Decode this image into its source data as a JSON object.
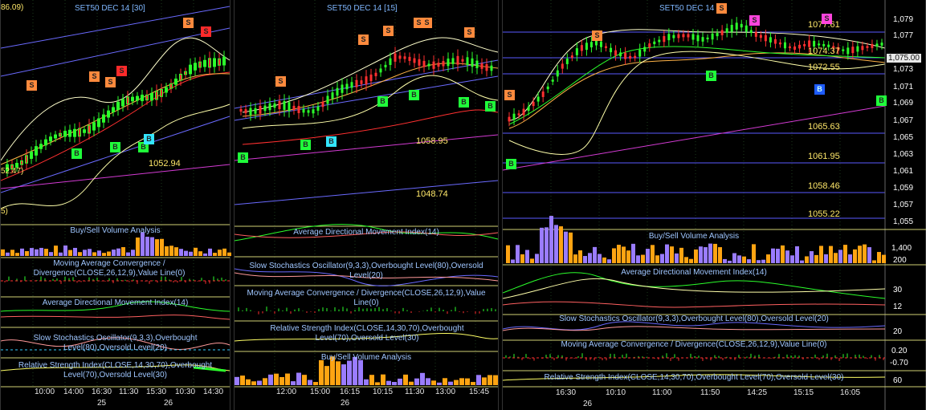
{
  "panels": [
    {
      "title": "SET50 DEC 14   [30]",
      "partial_value_top": "86.09)",
      "partial_value_left": "52.47)",
      "partial_value_small": "5)",
      "price_labels": [
        "1052.94"
      ],
      "indicators": [
        "Buy/Sell Volume Analysis",
        "Moving Average Convergence / Divergence(CLOSE,26,12,9),Value Line(0)",
        "Average Directional Movement Index(14)",
        "Slow Stochastics Oscillator(9,3,3),Overbought Level(80),Oversold Level(20)",
        "Relative Strength Index(CLOSE,14,30,70),Overbought Level(70),Oversold Level(30)"
      ],
      "x_ticks": [
        "10:00",
        "14:00",
        "16:30",
        "11:30",
        "15:30",
        "10:30",
        "14:30"
      ],
      "dates": [
        "25",
        "26"
      ],
      "signals": [
        "S",
        "S",
        "S",
        "S",
        "S",
        "S",
        "B",
        "B",
        "B",
        "B"
      ]
    },
    {
      "title": "SET50 DEC 14   [15]",
      "price_labels": [
        "1058.95",
        "1048.74"
      ],
      "indicators": [
        "Average Directional Movement Index(14)",
        "Slow Stochastics Oscillator(9,3,3),Overbought Level(80),Oversold Level(20)",
        "Moving Average Convergence / Divergence(CLOSE,26,12,9),Value Line(0)",
        "Relative Strength Index(CLOSE,14,30,70),Overbought Level(70),Oversold Level(30)",
        "Buy/Sell Volume Analysis"
      ],
      "x_ticks": [
        "12:00",
        "15:00",
        "16:15",
        "10:15",
        "11:30",
        "13:00",
        "15:45"
      ],
      "dates": [
        "26"
      ],
      "signals": [
        "S",
        "S",
        "S",
        "S",
        "S",
        "S",
        "B",
        "B",
        "B",
        "B",
        "B",
        "B",
        "B"
      ]
    },
    {
      "title": "SET50 DEC 14  [5]",
      "price_labels": [
        "1077.61",
        "1074.37",
        "1072.55",
        "1065.63",
        "1061.95",
        "1058.46",
        "1055.22"
      ],
      "price_axis": [
        "1,079",
        "1,077",
        "1,075.00",
        "1,073",
        "1,071",
        "1,069",
        "1,067",
        "1,065",
        "1,063",
        "1,061",
        "1,059",
        "1,057",
        "1,055"
      ],
      "vol_axis": [
        "1,400",
        "200"
      ],
      "adx_axis": [
        "30",
        "12"
      ],
      "stoch_axis": [
        "20"
      ],
      "macd_axis": [
        "0.20",
        "-0.70"
      ],
      "rsi_axis": [
        "60"
      ],
      "indicators": [
        "Buy/Sell Volume Analysis",
        "Average Directional Movement Index(14)",
        "Slow Stochastics Oscillator(9,3,3),Overbought Level(80),Oversold Level(20)",
        "Moving Average Convergence / Divergence(CLOSE,26,12,9),Value Line(0)",
        "Relative Strength Index(CLOSE,14,30,70),Overbought Level(70),Oversold Level(30)"
      ],
      "x_ticks": [
        "16:30",
        "10:10",
        "11:00",
        "11:50",
        "14:25",
        "15:15",
        "16:05"
      ],
      "dates": [
        "26"
      ],
      "signals": [
        "S",
        "S",
        "S",
        "S",
        "B",
        "B",
        "B",
        "B"
      ]
    }
  ],
  "chart_data": [
    {
      "type": "candlestick",
      "title": "SET50 DEC 14   [30]",
      "x": [
        "10:00",
        "14:00",
        "16:30",
        "11:30",
        "15:30",
        "10:30",
        "14:30"
      ],
      "price_levels": [
        1052.94
      ]
    },
    {
      "type": "candlestick",
      "title": "SET50 DEC 14   [15]",
      "x": [
        "12:00",
        "15:00",
        "16:15",
        "10:15",
        "11:30",
        "13:00",
        "15:45"
      ],
      "price_levels": [
        1058.95,
        1048.74
      ]
    },
    {
      "type": "candlestick",
      "title": "SET50 DEC 14  [5]",
      "x": [
        "16:30",
        "10:10",
        "11:00",
        "11:50",
        "14:25",
        "15:15",
        "16:05"
      ],
      "last_price": 1075.0,
      "ylim": [
        1054,
        1080
      ],
      "price_levels": [
        1077.61,
        1074.37,
        1072.55,
        1065.63,
        1061.95,
        1058.46,
        1055.22
      ],
      "series": [
        {
          "values": [
            1066.5,
            1067.5,
            1069.5,
            1072.5,
            1074.5,
            1075.2,
            1074.0,
            1073.4,
            1075.0,
            1075.8,
            1076.0,
            1075.5,
            1076.3,
            1077.2,
            1076.0,
            1075.3,
            1074.5,
            1075.1,
            1074.8,
            1074.2,
            1074.6,
            1075.0
          ]
        }
      ]
    }
  ]
}
